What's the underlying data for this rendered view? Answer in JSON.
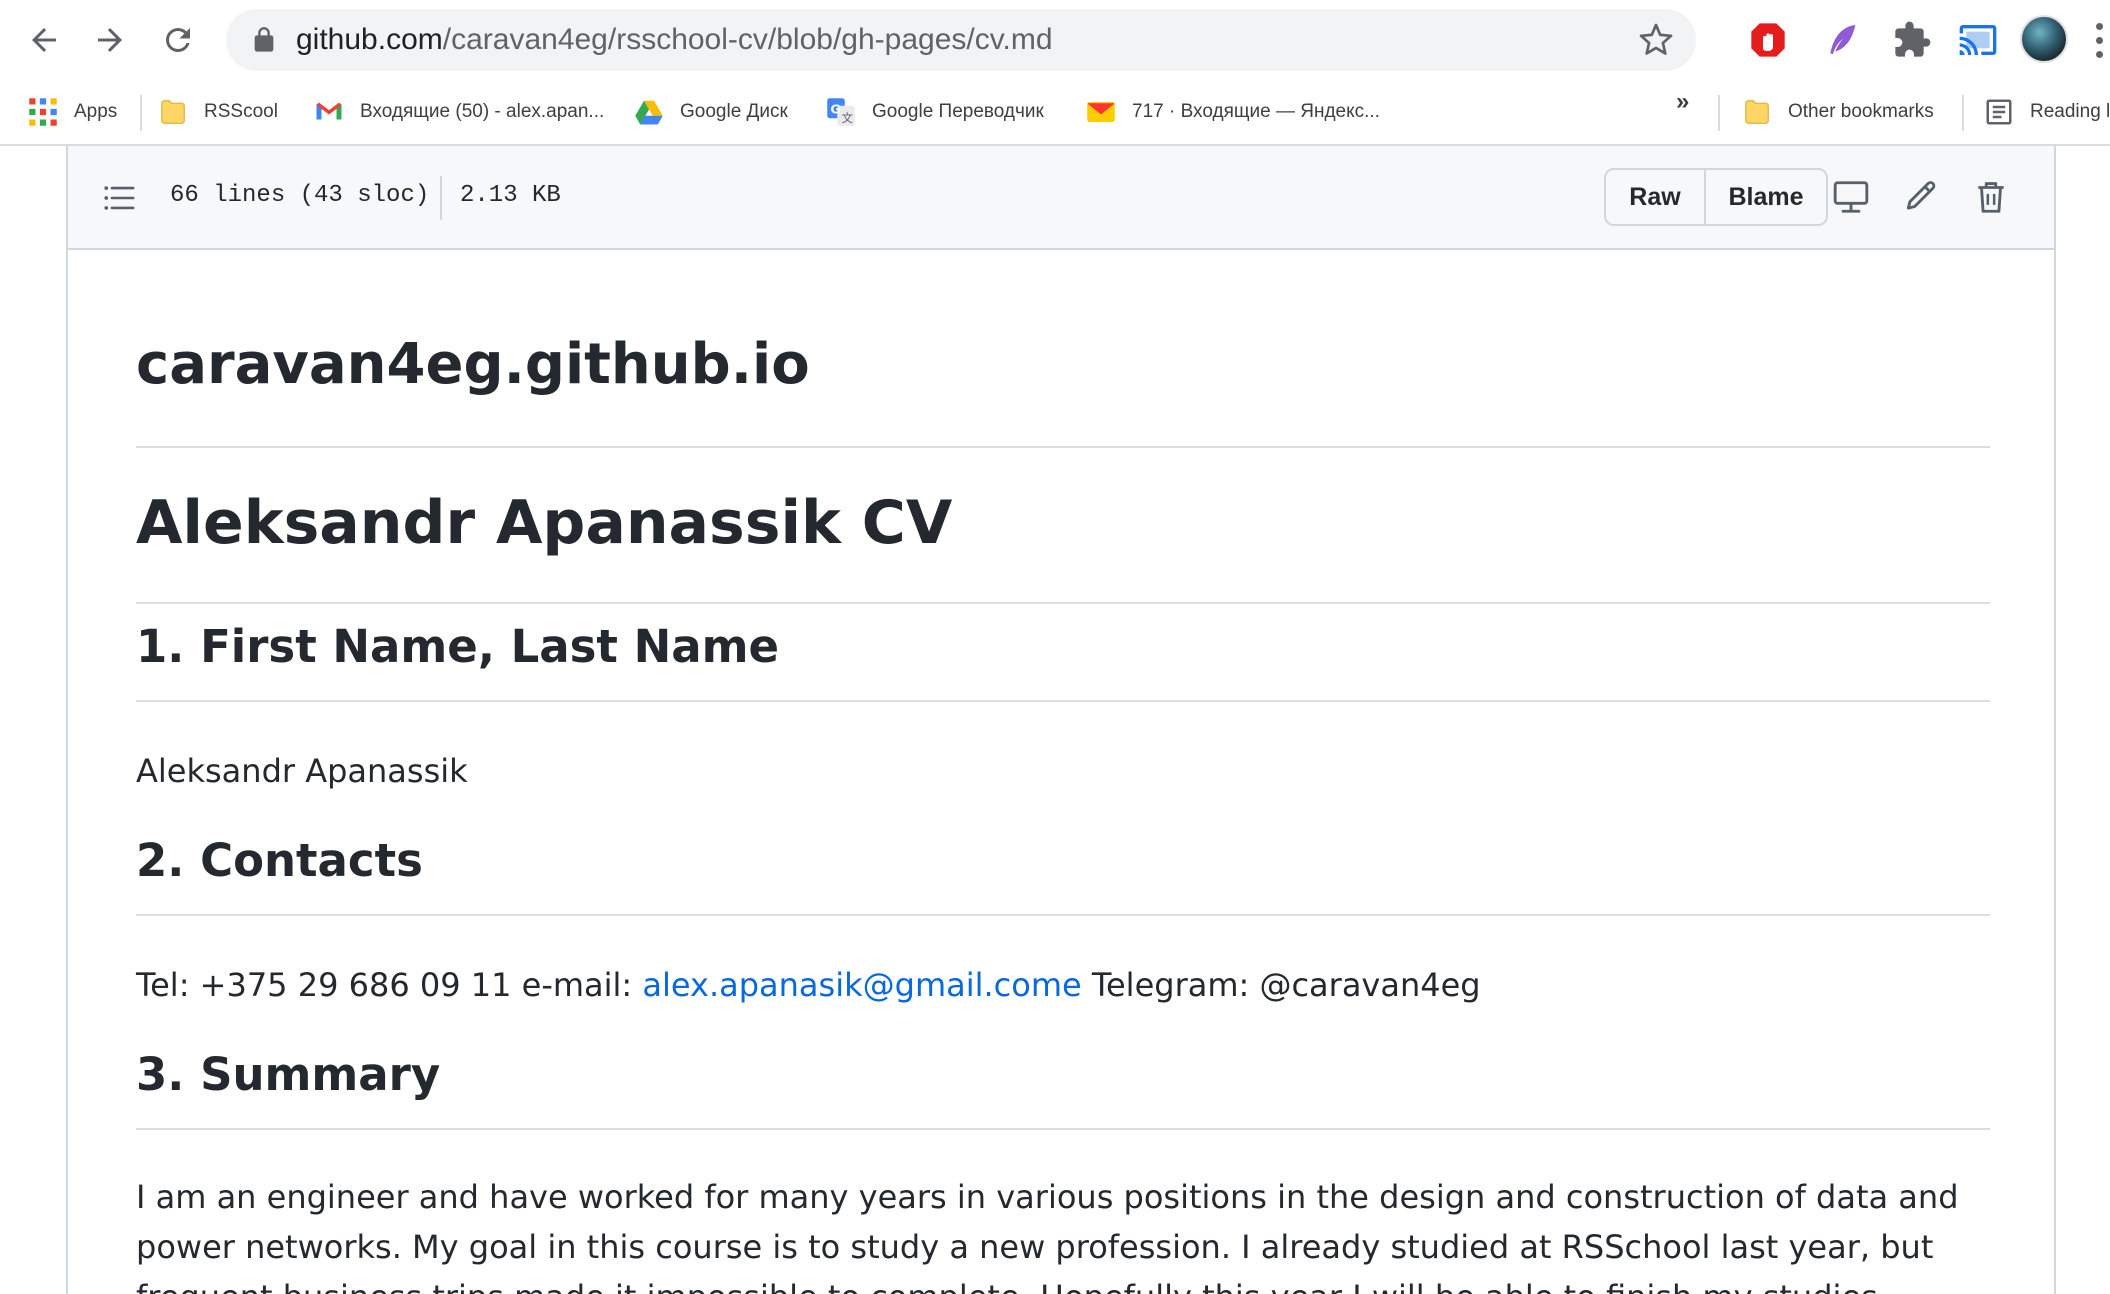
{
  "browser": {
    "url_host": "github.com",
    "url_path": "/caravan4eg/rsschool-cv/blob/gh-pages/cv.md",
    "bookmarks": [
      {
        "label": "Apps",
        "icon": "apps-grid-icon"
      },
      {
        "label": "RSScool",
        "icon": "folder-icon"
      },
      {
        "label": "Входящие (50) - alex.apan...",
        "icon": "gmail-icon"
      },
      {
        "label": "Google Диск",
        "icon": "google-drive-icon"
      },
      {
        "label": "Google Переводчик",
        "icon": "google-translate-icon"
      },
      {
        "label": "717 · Входящие — Яндекс...",
        "icon": "yandex-mail-icon"
      }
    ],
    "other_bookmarks": "Other bookmarks",
    "reading_list": "Reading l",
    "more_bookmarks": "»"
  },
  "file": {
    "lines_info": "66 lines (43 sloc)",
    "size": "2.13 KB",
    "raw_label": "Raw",
    "blame_label": "Blame"
  },
  "markdown": {
    "site_title": "caravan4eg.github.io",
    "cv_title": "Aleksandr Apanassik CV",
    "section1_heading": "1. First Name, Last Name",
    "section1_text": "Aleksandr Apanassik",
    "section2_heading": "2. Contacts",
    "contacts_prefix": "Tel: +375 29 686 09 11 e-mail: ",
    "contacts_email": "alex.apanasik@gmail.come",
    "contacts_suffix": " Telegram: @caravan4eg",
    "section3_heading": "3. Summary",
    "summary_text": "I am an engineer and have worked for many years in various positions in the design and construction of data and power networks. My goal in this course is to study a new profession. I already studied at RSSchool last year, but frequent business trips made it impossible to complete. Hopefully this year I will be able to finish my studies."
  },
  "colors": {
    "link": "#0969da",
    "text": "#24292f",
    "border": "#d0d7de"
  }
}
